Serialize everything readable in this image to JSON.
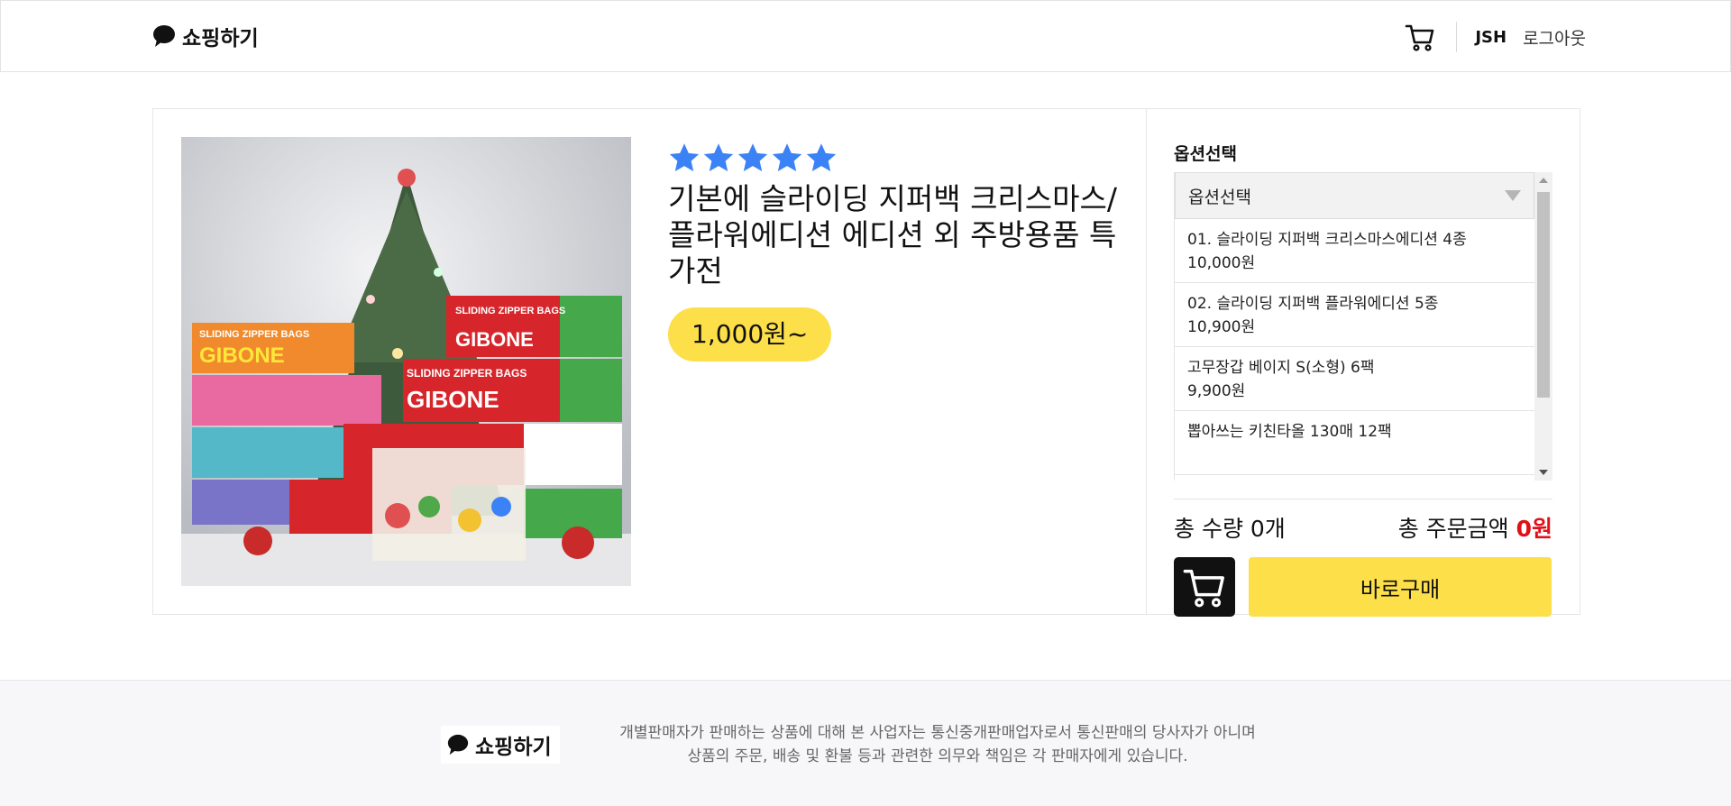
{
  "header": {
    "logo_text": "쇼핑하기",
    "user_name": "JSH",
    "logout_label": "로그아웃"
  },
  "product": {
    "rating": 5,
    "title": "기본에 슬라이딩 지퍼백 크리스마스/플라워에디션 에디션 외 주방용품 특가전",
    "price_label": "1,000원~",
    "image_text": {
      "brand": "GIBONE",
      "box_label": "SLIDING ZIPPER BAGS"
    }
  },
  "options": {
    "heading": "옵션선택",
    "select_placeholder": "옵션선택",
    "items": [
      {
        "name": "01. 슬라이딩 지퍼백 크리스마스에디션 4종",
        "price": "10,000원"
      },
      {
        "name": "02. 슬라이딩 지퍼백 플라워에디션 5종",
        "price": "10,900원"
      },
      {
        "name": "고무장갑 베이지 S(소형) 6팩",
        "price": "9,900원"
      },
      {
        "name": "뽑아쓰는 키친타올 130매 12팩",
        "price": ""
      }
    ]
  },
  "totals": {
    "quantity_label": "총 수량 0개",
    "amount_label": "총 주문금액",
    "amount_value": "0원"
  },
  "actions": {
    "buy_label": "바로구매"
  },
  "footer": {
    "logo_text": "쇼핑하기",
    "line1": "개별판매자가 판매하는 상품에 대해 본 사업자는 통신중개판매업자로서 통신판매의 당사자가 아니며",
    "line2": "상품의 주문, 배송 및 환불 등과 관련한 의무와 책임은 각 판매자에게 있습니다."
  },
  "colors": {
    "accent_yellow": "#fddf4a",
    "star_blue": "#3b82f6",
    "total_red": "#e0101a"
  }
}
